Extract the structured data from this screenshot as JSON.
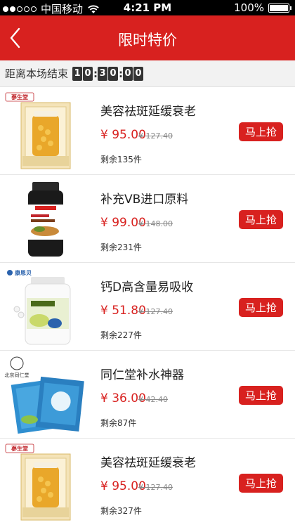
{
  "status_bar": {
    "carrier": "中国移动",
    "time": "4:21 PM",
    "battery": "100%",
    "battery_level": 1.0
  },
  "nav": {
    "title": "限时特价"
  },
  "countdown": {
    "label": "距离本场结束",
    "digits": [
      "1",
      "0",
      "3",
      "0",
      "0",
      "0"
    ]
  },
  "buy_label": "马上抢",
  "items": [
    {
      "name": "美容祛斑延缓衰老",
      "price": "¥ 95.00",
      "old_price": "¥ 127.40",
      "stock": "剩余135件",
      "brand": "蔘生堂"
    },
    {
      "name": "补充VB进口原料",
      "price": "¥ 99.00",
      "old_price": "¥ 148.00",
      "stock": "剩余231件",
      "brand": ""
    },
    {
      "name": "钙D高含量易吸收",
      "price": "¥ 51.80",
      "old_price": "¥ 127.40",
      "stock": "剩余227件",
      "brand": "康恩贝"
    },
    {
      "name": "同仁堂补水神器",
      "price": "¥ 36.00",
      "old_price": "¥ 42.40",
      "stock": "剩余87件",
      "brand": "北京同仁堂"
    },
    {
      "name": "美容祛斑延缓衰老",
      "price": "¥ 95.00",
      "old_price": "¥ 127.40",
      "stock": "剩余327件",
      "brand": "蔘生堂"
    }
  ],
  "colors": {
    "accent": "#d8211f",
    "countdown_bg": "#f2f2f2"
  }
}
